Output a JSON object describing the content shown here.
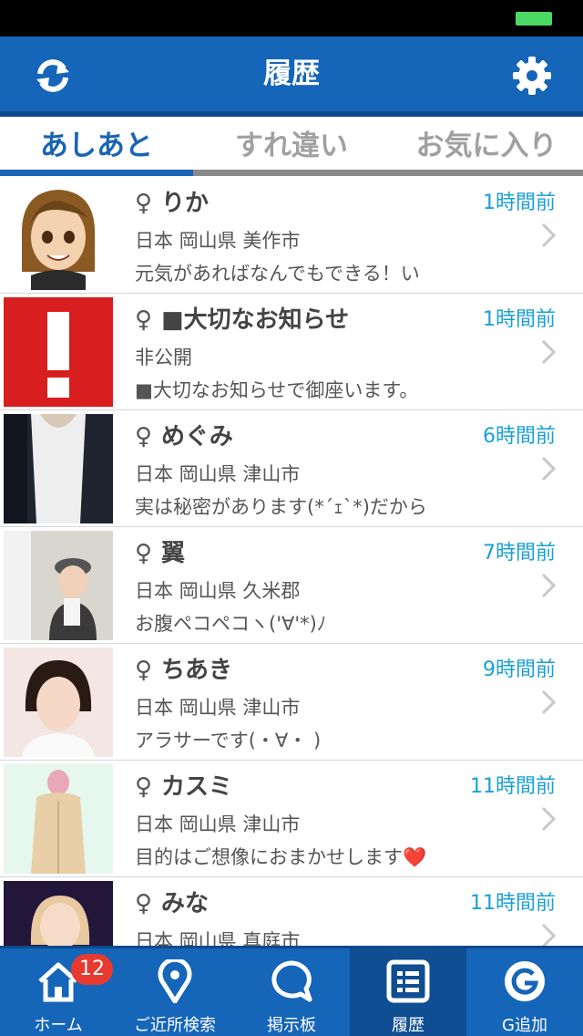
{
  "status_bar": {
    "battery_color": "#4cd964"
  },
  "header": {
    "title": "履歴",
    "left_icon": "refresh-icon",
    "right_icon": "gear-icon",
    "bg_color": "#1565b8"
  },
  "tabs": [
    {
      "label": "あしあと",
      "active": true
    },
    {
      "label": "すれ違い",
      "active": false
    },
    {
      "label": "お気に入り",
      "active": false
    }
  ],
  "history": [
    {
      "gender": "♀",
      "name": "りか",
      "time": "1時間前",
      "location": "日本 岡山県 美作市",
      "message": "元気があればなんでもできる！い",
      "avatar": "cartoon-avatar"
    },
    {
      "gender": "♀",
      "name": "■大切なお知らせ",
      "time": "1時間前",
      "location": "非公開",
      "message": "■大切なお知らせで御座います。",
      "avatar": "exclamation-avatar"
    },
    {
      "gender": "♀",
      "name": "めぐみ",
      "time": "6時間前",
      "location": "日本 岡山県 津山市",
      "message": "実は秘密があります(*´ｪ`*)だから",
      "avatar": "photo-avatar"
    },
    {
      "gender": "♀",
      "name": "翼",
      "time": "7時間前",
      "location": "日本 岡山県 久米郡",
      "message": "お腹ペコペコヽ('∀'*)ﾉ",
      "avatar": "photo-avatar"
    },
    {
      "gender": "♀",
      "name": "ちあき",
      "time": "9時間前",
      "location": "日本 岡山県 津山市",
      "message": "アラサーです(・∀・ )",
      "avatar": "photo-avatar"
    },
    {
      "gender": "♀",
      "name": "カスミ",
      "time": "11時間前",
      "location": "日本 岡山県 津山市",
      "message": "目的はご想像におまかせします❤️",
      "avatar": "photo-avatar"
    },
    {
      "gender": "♀",
      "name": "みな",
      "time": "11時間前",
      "location": "日本 岡山県 真庭市",
      "message": "",
      "avatar": "photo-avatar"
    }
  ],
  "tabbar": [
    {
      "label": "ホーム",
      "icon": "home-icon",
      "badge": "12",
      "active": false
    },
    {
      "label": "ご近所検索",
      "icon": "location-pin-icon",
      "active": false
    },
    {
      "label": "掲示板",
      "icon": "chat-bubble-icon",
      "active": false
    },
    {
      "label": "履歴",
      "icon": "list-icon",
      "active": true
    },
    {
      "label": "G追加",
      "icon": "g-icon",
      "active": false
    }
  ],
  "colors": {
    "accent": "#1aa0d6",
    "tab_active": "#1a64b4",
    "badge": "#e8392e"
  }
}
